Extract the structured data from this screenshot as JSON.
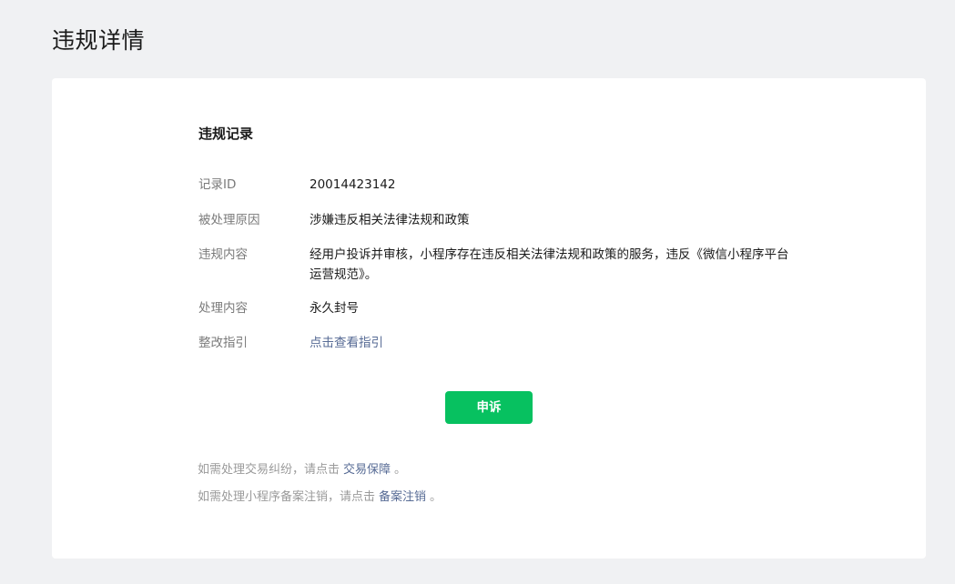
{
  "page": {
    "title": "违规详情"
  },
  "record": {
    "section_title": "违规记录",
    "rows": [
      {
        "label": "记录ID",
        "value": "20014423142"
      },
      {
        "label": "被处理原因",
        "value": "涉嫌违反相关法律法规和政策"
      },
      {
        "label": "违规内容",
        "value": "经用户投诉并审核，小程序存在违反相关法律法规和政策的服务，违反《微信小程序平台运营规范》。"
      },
      {
        "label": "处理内容",
        "value": "永久封号"
      },
      {
        "label": "整改指引",
        "value": "点击查看指引"
      }
    ]
  },
  "actions": {
    "appeal_label": "申诉"
  },
  "notes": {
    "trade": {
      "prefix": "如需处理交易纠纷，请点击",
      "link": "交易保障",
      "suffix": "。"
    },
    "filing": {
      "prefix": "如需处理小程序备案注销，请点击",
      "link": "备案注销",
      "suffix": "。"
    }
  },
  "colors": {
    "background": "#f0f1f3",
    "card": "#ffffff",
    "primary_button": "#07c160",
    "link": "#576b95",
    "label": "#7a7a7a",
    "note": "#9a9a9a"
  }
}
